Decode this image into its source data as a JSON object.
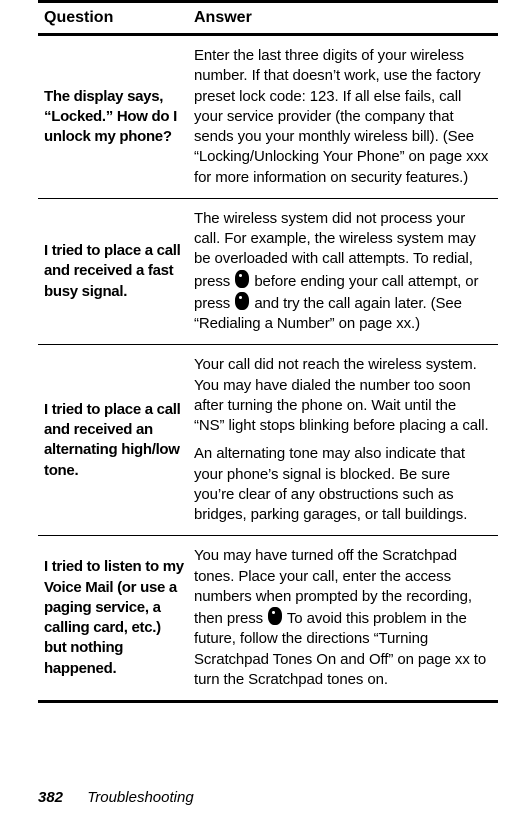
{
  "header": {
    "question": "Question",
    "answer": "Answer"
  },
  "rows": [
    {
      "q": "The display says, “Locked.” How do I unlock my phone?",
      "a": "Enter the last three digits of your wireless number. If that doesn’t work, use the factory preset lock code: 123. If all else fails, call your service provider (the company that sends you your monthly wireless bill). (See “Locking/Unlocking Your Phone” on page xxx for more information on security features.)"
    },
    {
      "q": "I tried to place a call and received a fast busy signal.",
      "a_pre_icon1": "The wireless system did not process your call. For example, the wireless system may be overloaded with call attempts. To redial, press ",
      "a_mid": " before ending your call attempt, or press ",
      "a_post_icon2": " and try the call again later. (See “Redialing a Number” on page xx.)"
    },
    {
      "q": "I tried to place a call and received an alternating high/low tone.",
      "a1": "Your call did not reach the wireless system. You may have dialed the number too soon after turning the phone on. Wait until the “NS” light stops blinking before placing a call.",
      "a2": "An alternating tone may also indicate that your phone’s signal is blocked. Be sure you’re clear of any obstructions such as bridges, parking garages, or tall buildings."
    },
    {
      "q": "I tried to listen to my Voice Mail (or use a paging service, a calling card, etc.) but nothing happened.",
      "a_pre_icon": "You may have turned off the Scratchpad tones. Place your call, enter the access numbers when prompted by the recording, then press ",
      "a_post_icon": "     To avoid this problem in the future, follow the directions “Turning Scratchpad Tones On and Off” on page xx to turn the Scratchpad tones on."
    }
  ],
  "footer": {
    "page": "382",
    "section": "Troubleshooting"
  }
}
